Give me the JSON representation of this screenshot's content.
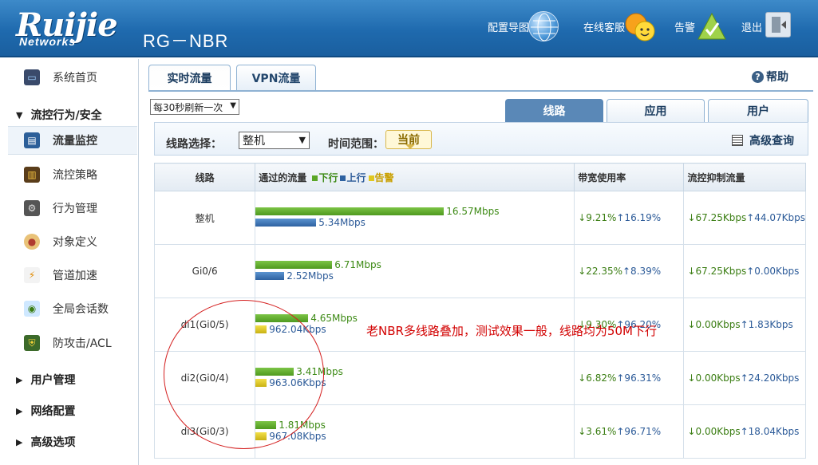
{
  "header": {
    "logo": "Ruijie",
    "logo_sub": "Networks",
    "product": "RG－NBR",
    "links": {
      "guide": "配置导图",
      "service": "在线客服",
      "alarm": "告警",
      "exit": "退出"
    },
    "icons": [
      "globe-icon",
      "smiley-icon",
      "alert-triangle-icon",
      "exit-door-icon"
    ]
  },
  "sidebar": {
    "items": [
      {
        "label": "系统首页",
        "icon": "monitor-icon"
      },
      {
        "label": "流控行为/安全",
        "section": true,
        "expanded": true
      },
      {
        "label": "流量监控",
        "icon": "traffic-monitor-icon",
        "active": true
      },
      {
        "label": "流控策略",
        "icon": "chart-policy-icon"
      },
      {
        "label": "行为管理",
        "icon": "behavior-icon"
      },
      {
        "label": "对象定义",
        "icon": "palette-icon"
      },
      {
        "label": "管道加速",
        "icon": "accelerate-icon"
      },
      {
        "label": "全局会话数",
        "icon": "chat-bubbles-icon"
      },
      {
        "label": "防攻击/ACL",
        "icon": "shield-icon"
      },
      {
        "label": "用户管理",
        "section": true
      },
      {
        "label": "网络配置",
        "section": true
      },
      {
        "label": "高级选项",
        "section": true
      }
    ]
  },
  "top_tabs": [
    {
      "label": "实时流量",
      "active": true
    },
    {
      "label": "VPN流量",
      "active": false
    }
  ],
  "help_label": "帮助",
  "refresh_select": "每30秒刷新一次",
  "view_tabs": [
    {
      "label": "线路",
      "active": true
    },
    {
      "label": "应用",
      "active": false
    },
    {
      "label": "用户",
      "active": false
    }
  ],
  "filter": {
    "line_label": "线路选择：",
    "line_value": "整机",
    "time_label": "时间范围：",
    "time_value": "当前",
    "advanced": "高级查询"
  },
  "table": {
    "headers": {
      "line": "线路",
      "traffic": "通过的流量",
      "legend_down": "下行",
      "legend_up": "上行",
      "legend_alarm": "告警",
      "bandwidth": "带宽使用率",
      "suppressed": "流控抑制流量"
    },
    "colors": {
      "down": "#5aa626",
      "up": "#2e62a1",
      "alarm": "#e0c820"
    },
    "rows": [
      {
        "line": "整机",
        "down_label": "16.57Mbps",
        "down_frac": 0.59,
        "up_label": "5.34Mbps",
        "up_frac": 0.19,
        "up_style": "up",
        "rate_down": "↓9.21%",
        "rate_up": "↑16.19%",
        "sup_down": "↓67.25Kbps",
        "sup_up": "↑44.07Kbps"
      },
      {
        "line": "Gi0/6",
        "down_label": "6.71Mbps",
        "down_frac": 0.24,
        "up_label": "2.52Mbps",
        "up_frac": 0.09,
        "up_style": "up",
        "rate_down": "↓22.35%",
        "rate_up": "↑8.39%",
        "sup_down": "↓67.25Kbps",
        "sup_up": "↑0.00Kbps"
      },
      {
        "line": "di1(Gi0/5)",
        "down_label": "4.65Mbps",
        "down_frac": 0.165,
        "up_label": "962.04Kbps",
        "up_frac": 0.035,
        "up_style": "alarm",
        "rate_down": "↓9.30%",
        "rate_up": "↑96.20%",
        "sup_down": "↓0.00Kbps",
        "sup_up": "↑1.83Kbps"
      },
      {
        "line": "di2(Gi0/4)",
        "down_label": "3.41Mbps",
        "down_frac": 0.12,
        "up_label": "963.06Kbps",
        "up_frac": 0.035,
        "up_style": "alarm",
        "rate_down": "↓6.82%",
        "rate_up": "↑96.31%",
        "sup_down": "↓0.00Kbps",
        "sup_up": "↑24.20Kbps"
      },
      {
        "line": "di3(Gi0/3)",
        "down_label": "1.81Mbps",
        "down_frac": 0.065,
        "up_label": "967.08Kbps",
        "up_frac": 0.035,
        "up_style": "alarm",
        "rate_down": "↓3.61%",
        "rate_up": "↑96.71%",
        "sup_down": "↓0.00Kbps",
        "sup_up": "↑18.04Kbps"
      }
    ]
  },
  "annotation": "老NBR多线路叠加，测试效果一般，线路均为50M下行"
}
